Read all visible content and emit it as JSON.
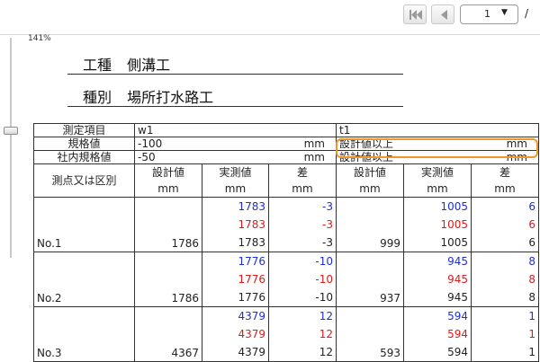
{
  "toolbar": {
    "page_value": "1",
    "page_separator": "/"
  },
  "zoom": {
    "label": "141%"
  },
  "headings": {
    "line1_key": "工種",
    "line1_val": "側溝工",
    "line2_key": "種別",
    "line2_val": "場所打水路工"
  },
  "table": {
    "row_measure_label": "測定項目",
    "w1_label": "w1",
    "t1_label": "t1",
    "spec_label": "規格値",
    "spec_w1": "-100",
    "spec_t1": "設計値以上",
    "internal_label": "社内規格値",
    "internal_w1": "-50",
    "internal_t1": "設計値以上",
    "unit": "mm",
    "point_header": "測点又は区別",
    "col_design": "設計値",
    "col_actual": "実測値",
    "col_diff": "差",
    "col_unit": "mm",
    "rows": [
      {
        "point": "No.1",
        "w_design": "1786",
        "w_actual": [
          "1783",
          "1783",
          "1783"
        ],
        "w_diff": [
          "-3",
          "-3",
          "-3"
        ],
        "t_design": "999",
        "t_actual": [
          "1005",
          "1005",
          "1005"
        ],
        "t_diff": [
          "6",
          "6",
          "6"
        ]
      },
      {
        "point": "No.2",
        "w_design": "1786",
        "w_actual": [
          "1776",
          "1776",
          "1776"
        ],
        "w_diff": [
          "-10",
          "-10",
          "-10"
        ],
        "t_design": "937",
        "t_actual": [
          "945",
          "945",
          "945"
        ],
        "t_diff": [
          "8",
          "8",
          "8"
        ]
      },
      {
        "point": "No.3",
        "w_design": "4367",
        "w_actual": [
          "4379",
          "4379",
          "4379"
        ],
        "w_diff": [
          "12",
          "12",
          "12"
        ],
        "t_design": "593",
        "t_actual": [
          "594",
          "594",
          "594"
        ],
        "t_diff": [
          "1",
          "1",
          "1"
        ]
      }
    ]
  },
  "colors": {
    "blue": "#1d2ed8",
    "red": "#e01818",
    "highlight": "#f0962a"
  },
  "icons": [
    "first-page-icon",
    "previous-page-icon",
    "dropdown-caret-icon"
  ]
}
